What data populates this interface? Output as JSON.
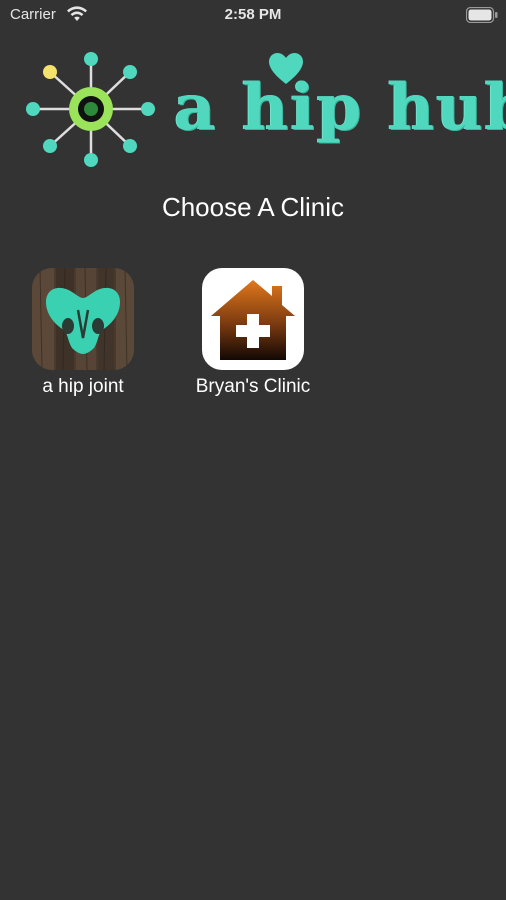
{
  "status_bar": {
    "carrier": "Carrier",
    "time": "2:58 PM",
    "icons": [
      "wifi-icon",
      "battery-icon"
    ]
  },
  "logo": {
    "text": "a hip hub",
    "accent_color": "#4fd8be",
    "icons": [
      "hub-icon",
      "heart-icon"
    ]
  },
  "heading": "Choose A Clinic",
  "clinics": [
    {
      "label": "a hip joint",
      "icon": "pelvis-icon"
    },
    {
      "label": "Bryan's Clinic",
      "icon": "house-medical-icon"
    }
  ],
  "colors": {
    "background": "#333333",
    "text": "#ffffff",
    "teal": "#4fd8be",
    "lime": "#9be35a",
    "yellow": "#f3e36b",
    "orange": "#e0781c"
  }
}
